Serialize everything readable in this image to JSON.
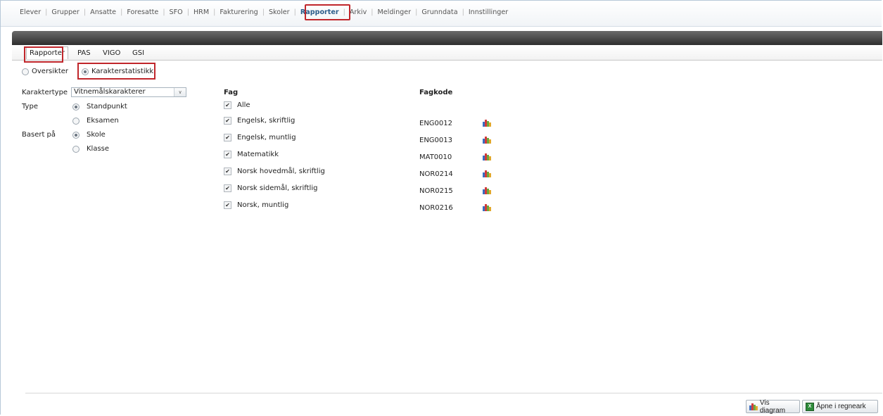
{
  "topnav": {
    "items": [
      {
        "label": "Elever"
      },
      {
        "label": "Grupper"
      },
      {
        "label": "Ansatte"
      },
      {
        "label": "Foresatte"
      },
      {
        "label": "SFO"
      },
      {
        "label": "HRM"
      },
      {
        "label": "Fakturering"
      },
      {
        "label": "Skoler"
      },
      {
        "label": "Rapporter",
        "active": true
      },
      {
        "label": "Arkiv"
      },
      {
        "label": "Meldinger"
      },
      {
        "label": "Grunndata"
      },
      {
        "label": "Innstillinger"
      }
    ]
  },
  "subtabs": [
    {
      "label": "Rapporter",
      "active": true
    },
    {
      "label": "PAS"
    },
    {
      "label": "VIGO"
    },
    {
      "label": "GSI"
    }
  ],
  "mode": {
    "options": [
      {
        "label": "Oversikter",
        "selected": false
      },
      {
        "label": "Karakterstatistikk",
        "selected": true
      }
    ]
  },
  "form": {
    "karaktertype_label": "Karaktertype",
    "karaktertype_value": "Vitnemålskarakterer",
    "type_label": "Type",
    "type_options": [
      {
        "label": "Standpunkt",
        "selected": true
      },
      {
        "label": "Eksamen",
        "selected": false
      }
    ],
    "basert_label": "Basert på",
    "basert_options": [
      {
        "label": "Skole",
        "selected": true
      },
      {
        "label": "Klasse",
        "selected": false
      }
    ]
  },
  "subjects": {
    "fag_header": "Fag",
    "fagkode_header": "Fagkode",
    "alle_label": "Alle",
    "rows": [
      {
        "name": "Engelsk, skriftlig",
        "code": "ENG0012",
        "checked": true
      },
      {
        "name": "Engelsk, muntlig",
        "code": "ENG0013",
        "checked": true
      },
      {
        "name": "Matematikk",
        "code": "MAT0010",
        "checked": true
      },
      {
        "name": "Norsk hovedmål, skriftlig",
        "code": "NOR0214",
        "checked": true
      },
      {
        "name": "Norsk sidemål, skriftlig",
        "code": "NOR0215",
        "checked": true
      },
      {
        "name": "Norsk, muntlig",
        "code": "NOR0216",
        "checked": true
      }
    ]
  },
  "footer": {
    "vis_diagram": "Vis diagram",
    "apne_regneark": "Åpne i regneark"
  },
  "colors": {
    "highlight": "#c0262b",
    "active_nav": "#2b5c8a"
  }
}
